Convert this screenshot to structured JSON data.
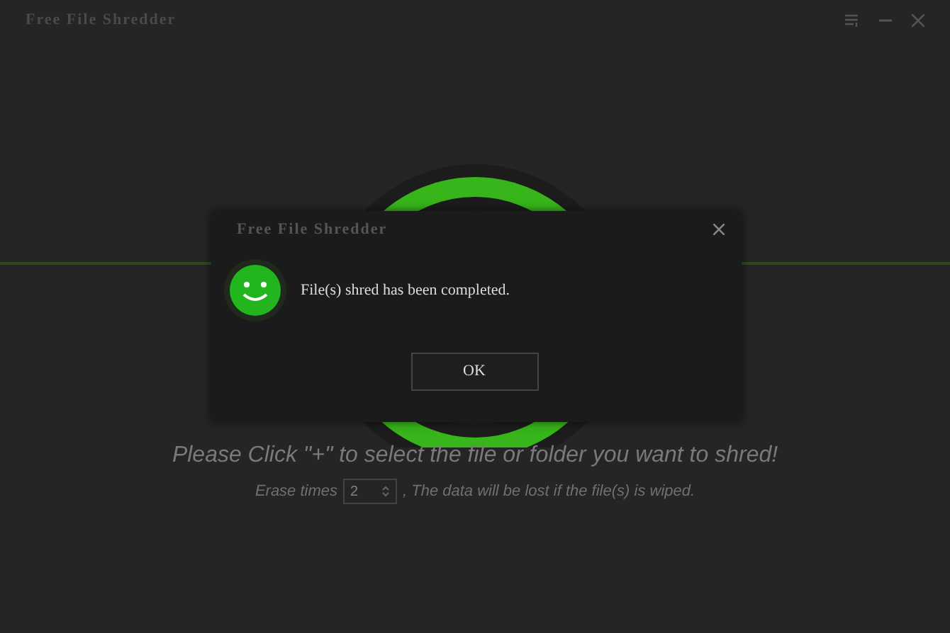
{
  "window": {
    "title": "Free File Shredder"
  },
  "main": {
    "prompt": "Please Click \"+\" to select the file or folder you want to shred!",
    "erase_label": "Erase times",
    "erase_value": "2",
    "erase_note": ", The data will be lost if the file(s) is wiped."
  },
  "dialog": {
    "title": "Free File Shredder",
    "message": "File(s) shred has been completed.",
    "button": "OK"
  }
}
